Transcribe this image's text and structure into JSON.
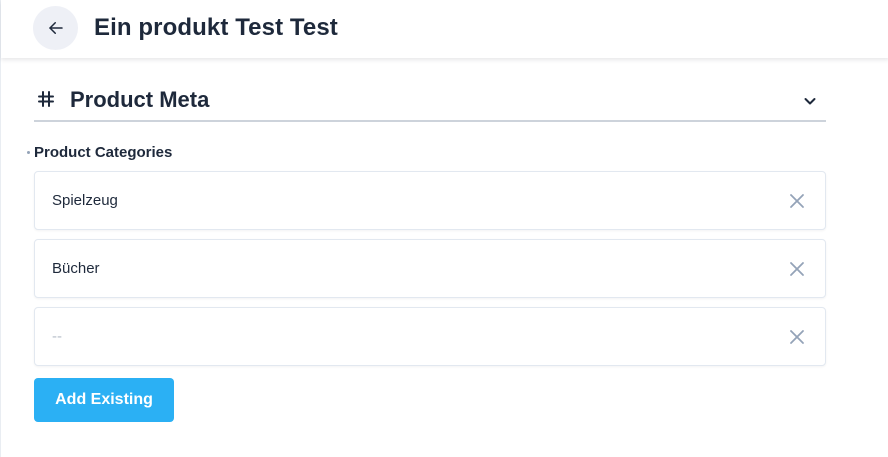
{
  "header": {
    "back_icon": "arrow-left-icon",
    "title": "Ein produkt Test Test"
  },
  "section": {
    "icon": "hash-icon",
    "title": "Product Meta",
    "toggle_icon": "chevron-down-icon"
  },
  "field": {
    "label": "Product Categories",
    "items": [
      {
        "value": "Spielzeug",
        "remove_icon": "close-icon"
      },
      {
        "value": "Bücher",
        "remove_icon": "close-icon"
      },
      {
        "value": "--",
        "remove_icon": "close-icon"
      }
    ],
    "add_button_label": "Add Existing"
  },
  "colors": {
    "accent": "#2bb0f4",
    "text": "#1e293b",
    "icon_muted": "#94a3b8"
  }
}
